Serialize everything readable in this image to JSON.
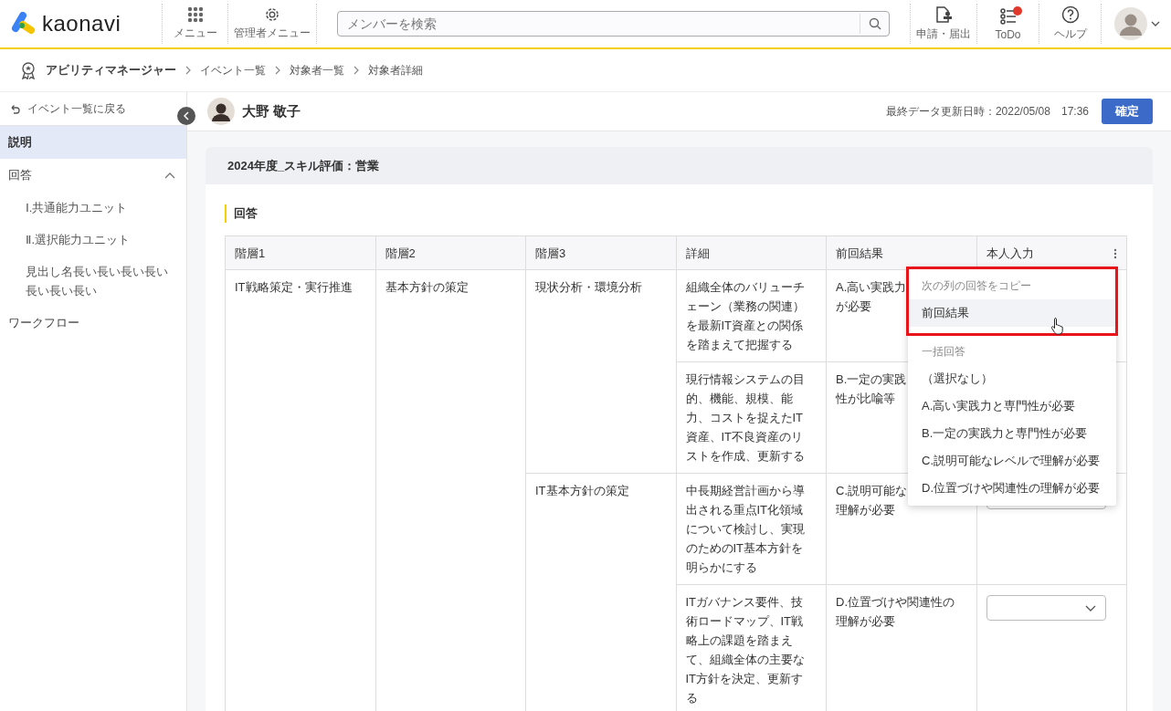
{
  "header": {
    "logo": "kaonavi",
    "nav_left": [
      {
        "kind": "grid",
        "label": "メニュー"
      },
      {
        "kind": "gear",
        "label": "管理者メニュー"
      }
    ],
    "search": {
      "placeholder": "メンバーを検索"
    },
    "nav_right": [
      {
        "kind": "stamp",
        "label": "申請・届出",
        "badge": false
      },
      {
        "kind": "todo",
        "label": "ToDo",
        "badge": true
      },
      {
        "kind": "help",
        "label": "ヘルプ",
        "badge": false
      }
    ]
  },
  "breadcrumb": [
    "アビリティマネージャー",
    "イベント一覧",
    "対象者一覧",
    "対象者詳細"
  ],
  "sidebar": {
    "back_link": "イベント一覧に戻る",
    "items": [
      {
        "kind": "link",
        "label": "説明",
        "selected": true
      },
      {
        "kind": "group",
        "label": "回答",
        "selected": false,
        "expanded": true,
        "children": [
          {
            "label": "Ⅰ.共通能力ユニット",
            "selected": false
          },
          {
            "label": "Ⅱ.選択能力ユニット",
            "selected": false
          },
          {
            "label": "見出し名長い長い長い長い長い長い長い",
            "selected": false
          }
        ]
      },
      {
        "kind": "link",
        "label": "ワークフロー",
        "selected": false
      }
    ]
  },
  "subject": {
    "name": "大野 敬子",
    "updated": "最終データ更新日時：2022/05/08　17:36",
    "confirm_button": "確定"
  },
  "card": {
    "title": "2024年度_スキル評価：営業",
    "section": "回答",
    "table": {
      "columns": [
        "階層1",
        "階層2",
        "階層3",
        "詳細",
        "前回結果",
        "本人入力"
      ],
      "level1": "IT戦略策定・実行推進",
      "level2": "基本方針の策定",
      "groups": [
        {
          "level3": "現状分析・環境分析",
          "rows": [
            {
              "detail": "組織全体のバリューチェーン（業務の関連）を最新IT資産との関係を踏まえて把握する",
              "previous": [
                "A.高い実践力",
                "が必要"
              ]
            },
            {
              "detail": "現行情報システムの目的、機能、規模、能力、コストを捉えたIT資産、IT不良資産のリストを作成、更新する",
              "previous": [
                "B.一定の実践",
                "性が比喩等"
              ]
            }
          ]
        },
        {
          "level3": "IT基本方針の策定",
          "rows": [
            {
              "detail": "中長期経営計画から導出される重点IT化領域について検討し、実現のためのIT基本方針を明らかにする",
              "previous": [
                "C.説明可能な",
                "理解が必要"
              ],
              "answer": {
                "kind": "field_edge"
              }
            },
            {
              "detail": "ITガバナンス要件、技術ロードマップ、IT戦略上の課題を踏まえて、組織全体の主要なIT方針を決定、更新する",
              "previous": [
                "D.位置づけや関連性の",
                "理解が必要"
              ],
              "answer": {
                "kind": "select"
              }
            }
          ]
        }
      ]
    },
    "menu": {
      "sections": [
        {
          "heading": "次の列の回答をコピー",
          "items": [
            {
              "label": "前回結果",
              "hovered": true
            }
          ]
        },
        {
          "heading": "一括回答",
          "items": [
            {
              "label": "（選択なし）",
              "hovered": false
            },
            {
              "label": "A.高い実践力と専門性が必要",
              "hovered": false
            },
            {
              "label": "B.一定の実践力と専門性が必要",
              "hovered": false
            },
            {
              "label": "C.説明可能なレベルで理解が必要",
              "hovered": false
            },
            {
              "label": "D.位置づけや関連性の理解が必要",
              "hovered": false
            }
          ]
        }
      ]
    }
  }
}
